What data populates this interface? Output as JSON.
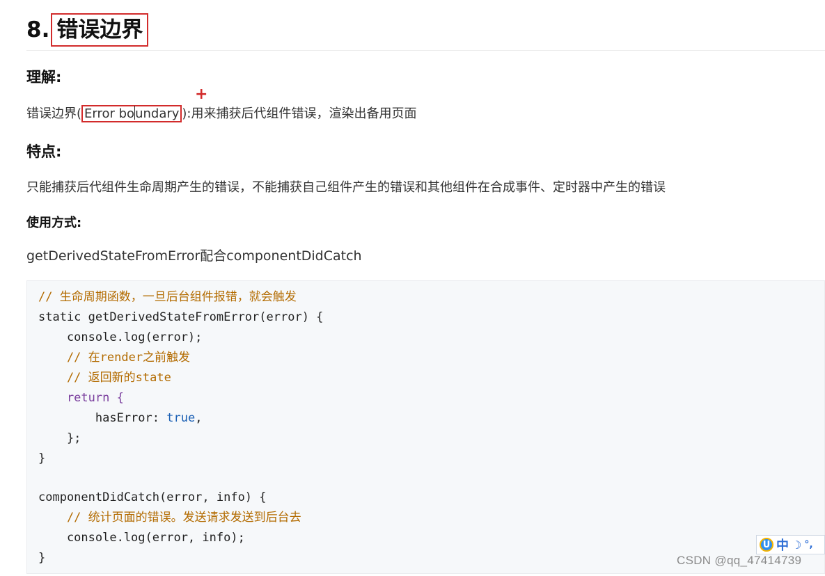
{
  "heading": {
    "number": "8.",
    "title": "错误边界"
  },
  "sections": {
    "understanding_title": "理解:",
    "understanding_text_prefix": "错误边界(",
    "understanding_term_a": "Error bo",
    "understanding_term_b": "undary",
    "understanding_text_suffix": "):用来捕获后代组件错误，渲染出备用页面",
    "plus_mark": "+",
    "features_title": "特点:",
    "features_text": "只能捕获后代组件生命周期产生的错误，不能捕获自己组件产生的错误和其他组件在合成事件、定时器中产生的错误",
    "usage_title": "使用方式:",
    "usage_text": "getDerivedStateFromError配合componentDidCatch"
  },
  "code": {
    "lines": [
      "// 生命周期函数，一旦后台组件报错，就会触发",
      "static getDerivedStateFromError(error) {",
      "    console.log(error);",
      "    // 在render之前触发",
      "    // 返回新的state",
      "    return {",
      "        hasError",
      ": ",
      "true",
      ",",
      "    };",
      "}",
      "componentDidCatch(error, info) {",
      "    // 统计页面的错误。发送请求发送到后台去",
      "    console.log(error, info);",
      "}"
    ]
  },
  "ime": {
    "lang": "中",
    "moon": "☽",
    "punct": "°,"
  },
  "watermark": "CSDN @qq_47414739",
  "colors": {
    "highlight_box": "#d22b2b",
    "code_bg": "#f6f8fa",
    "comment": "#b36b00",
    "keyword": "#7a3e9d",
    "value": "#1a5fb4"
  }
}
